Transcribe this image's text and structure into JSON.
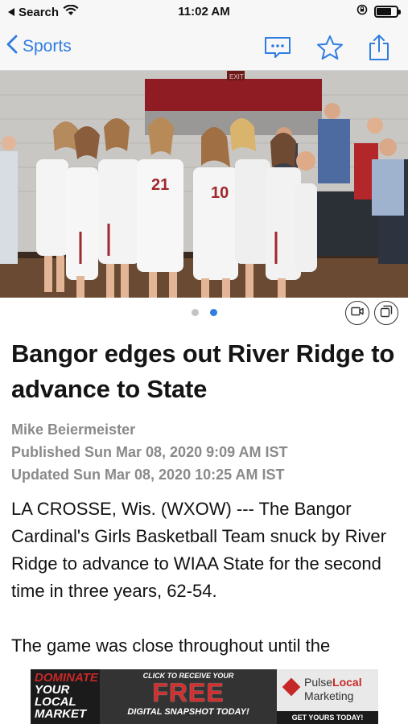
{
  "status_bar": {
    "back_app": "Search",
    "time": "11:02 AM",
    "battery_level": 0.75
  },
  "nav": {
    "back_label": "Sports",
    "icons": [
      "comment-icon",
      "star-icon",
      "share-icon"
    ]
  },
  "hero": {
    "sign_text": "EXIT",
    "jersey_numbers": [
      "21",
      "10"
    ]
  },
  "carousel": {
    "total": 2,
    "active": 2,
    "icons": [
      "video-icon",
      "gallery-icon"
    ]
  },
  "article": {
    "headline": "Bangor edges out River Ridge to advance to State",
    "author": "Mike Beiermeister",
    "published": "Published Sun Mar 08, 2020 9:09 AM IST",
    "updated": "Updated Sun Mar 08, 2020 10:25 AM IST",
    "paragraphs": [
      "LA CROSSE, Wis. (WXOW) --- The Bangor Cardinal's Girls Basketball Team snuck by River Ridge to advance to WIAA State for the second time in three years, 62-54.",
      "The game was close throughout until the"
    ]
  },
  "ad": {
    "left_lines": [
      "DOMINATE",
      "YOUR",
      "LOCAL",
      "MARKET"
    ],
    "cta": "CLICK TO RECEIVE YOUR",
    "free": "FREE",
    "snapshot": "DIGITAL SNAPSHOT TODAY!",
    "brand_pulse": "Pulse",
    "brand_local": "Local",
    "brand_marketing": "Marketing",
    "get": "GET YOURS TODAY!",
    "accent_color": "#c62828"
  },
  "colors": {
    "ios_blue": "#2f7de1",
    "meta_gray": "#8a8a8a"
  }
}
